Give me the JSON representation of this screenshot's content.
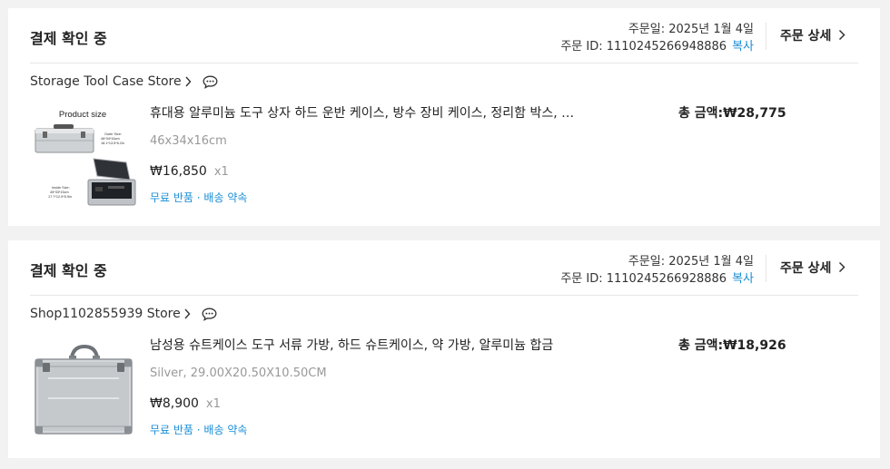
{
  "orders": [
    {
      "status": "결제 확인 중",
      "order_date": "주문일: 2025년 1월 4일",
      "order_id": "주문 ID: 1110245266948886",
      "copy_label": "복사",
      "detail_label": "주문 상세",
      "store_name": "Storage Tool Case Store",
      "product_name": "휴대용 알루미늄 도구 상자 하드 운반 케이스, 방수 장비 케이스, 정리함 박스, 보관 케이스",
      "variant": "46x34x16cm",
      "price": "₩16,850",
      "qty": "x1",
      "promo": "무료 반품 · 배송 약속",
      "total": "총 금액:₩28,775",
      "thumb_texts": {
        "title": "Product size",
        "outer_label": "Outer Size:",
        "outer_cm": "46*34*16cm",
        "outer_in": "18.1*13.5*6.2in",
        "inner_label": "Inside Size:",
        "inner_cm": "45*33*15cm",
        "inner_in": "17.7*12.9*5.9in"
      }
    },
    {
      "status": "결제 확인 중",
      "order_date": "주문일: 2025년 1월 4일",
      "order_id": "주문 ID: 1110245266928886",
      "copy_label": "복사",
      "detail_label": "주문 상세",
      "store_name": "Shop1102855939 Store",
      "product_name": "남성용 슈트케이스 도구 서류 가방, 하드 슈트케이스, 약 가방, 알루미늄 합금",
      "variant": "Silver, 29.00X20.50X10.50CM",
      "price": "₩8,900",
      "qty": "x1",
      "promo": "무료 반품 · 배송 약속",
      "total": "총 금액:₩18,926"
    }
  ],
  "icons": {
    "chevron": "chevron-right-icon",
    "chat": "chat-bubble-icon"
  },
  "colors": {
    "link": "#1a8ed6",
    "background": "#f2f2f2",
    "card": "#ffffff"
  }
}
